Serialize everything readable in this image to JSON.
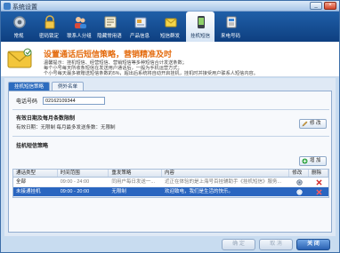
{
  "window": {
    "title": "系统设置",
    "buttons": {
      "minimize": "_",
      "close": "×"
    }
  },
  "toolbar": {
    "items": [
      {
        "label": "常规",
        "icon": "gear-icon",
        "active": false
      },
      {
        "label": "密码锁定",
        "icon": "lock-icon",
        "active": false
      },
      {
        "label": "联系人分组",
        "icon": "contacts-icon",
        "active": false
      },
      {
        "label": "隐藏常用语",
        "icon": "phrases-icon",
        "active": false
      },
      {
        "label": "产品信息",
        "icon": "product-icon",
        "active": false
      },
      {
        "label": "短信群发",
        "icon": "sms-icon",
        "active": false
      },
      {
        "label": "挂机短信",
        "icon": "hangup-sms-icon",
        "active": true
      },
      {
        "label": "来电号码",
        "icon": "caller-id-icon",
        "active": false
      }
    ]
  },
  "banner": {
    "title": "设置通话后短信策略，营销精准及时",
    "lines": [
      "温馨提示：挂机短信、经营短信、营销短信等多种短信合计发送条数；",
      "每个小号每天所收条短信在发送用户通话后，一般为手机运营方式；",
      "个小号每天最多被赠送短信条数的5%，超出后系统将自动开启挂机，挂机时并接受用户联系人短信内容。"
    ]
  },
  "tabs": [
    {
      "label": "挂机短信策略",
      "active": true
    },
    {
      "label": "例外名单",
      "active": false
    }
  ],
  "phone": {
    "label": "电话号码",
    "value": "02162109344"
  },
  "validity": {
    "title": "有效日期及每月条数限制",
    "line": "有效日期：无限制   每月最多发送条数：无限制",
    "edit_label": "修 改"
  },
  "strategy": {
    "title": "挂机短信策略",
    "add_label": "增 加"
  },
  "table": {
    "headers": [
      "通话类型",
      "时间范围",
      "重发策略",
      "内容",
      "修改",
      "删除"
    ],
    "rows": [
      {
        "type": "全部",
        "time": "09:00 - 24:00",
        "freq": "同用户每日发送一...",
        "content": "近正在体验的是上海号百挂辅助手《挂机短信》服务...",
        "selected": false
      },
      {
        "type": "未接通挂机",
        "time": "09:00 - 20:00",
        "freq": "无限制",
        "content": "欢迎致电，我们是生活的快乐。",
        "selected": true
      }
    ]
  },
  "footer": {
    "ok": "确 定",
    "cancel": "取 消",
    "close": "关 闭"
  },
  "colors": {
    "accent": "#2a66c0",
    "banner_title": "#e36a0c",
    "toolbar": "#1a559e"
  }
}
